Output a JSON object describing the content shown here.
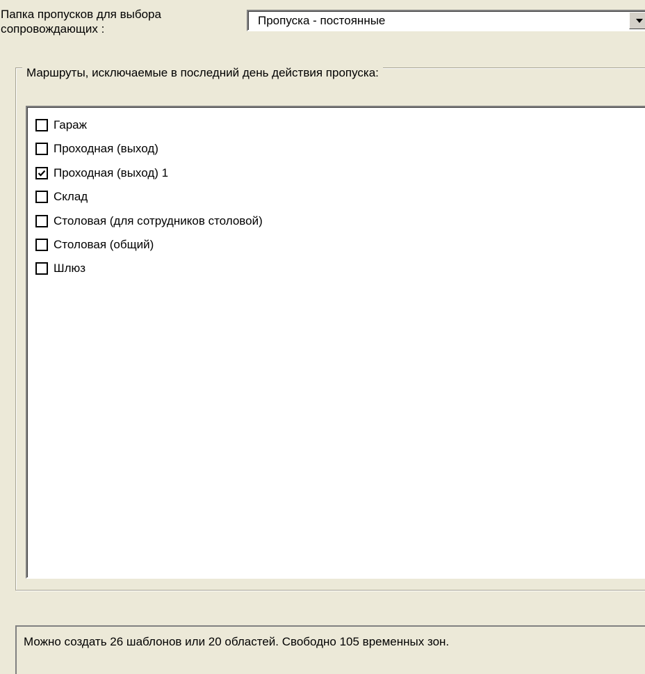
{
  "folder": {
    "label": "Папка пропусков для выбора сопровождающих :",
    "selected": "Пропуска - постоянные"
  },
  "routes": {
    "title": "Маршруты, исключаемые в последний день действия пропуска:",
    "items": [
      {
        "label": "Гараж",
        "checked": false
      },
      {
        "label": "Проходная (выход)",
        "checked": false
      },
      {
        "label": "Проходная (выход) 1",
        "checked": true
      },
      {
        "label": "Склад",
        "checked": false
      },
      {
        "label": "Столовая (для сотрудников столовой)",
        "checked": false
      },
      {
        "label": "Столовая (общий)",
        "checked": false
      },
      {
        "label": "Шлюз",
        "checked": false
      }
    ]
  },
  "status": {
    "text": "Можно создать 26 шаблонов или 20 областей. Свободно 105 временных зон."
  }
}
